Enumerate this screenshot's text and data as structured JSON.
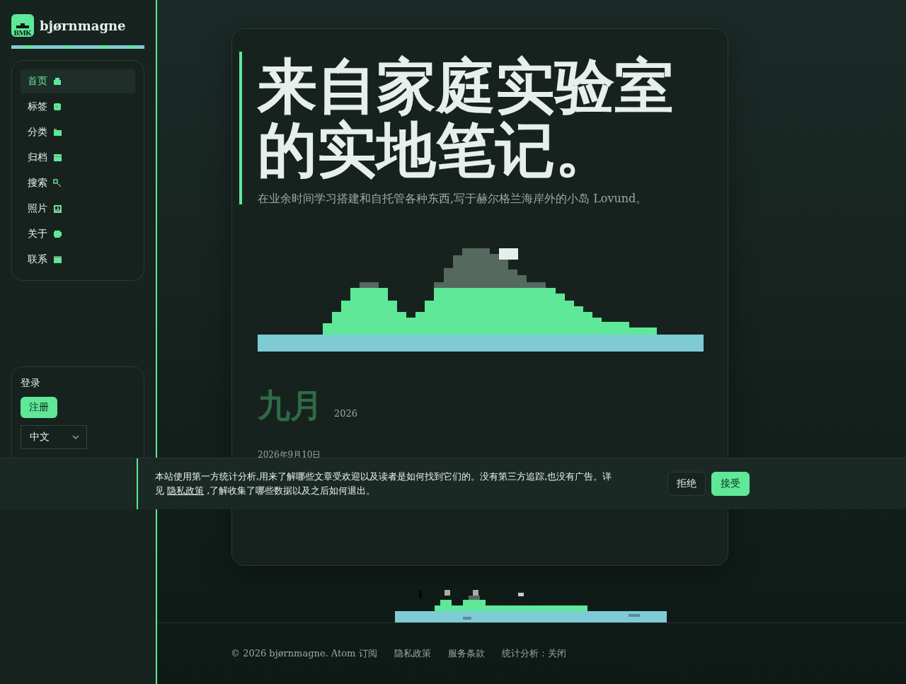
{
  "brand": {
    "logo_text": "BMK",
    "name": "bjørnmagne"
  },
  "nav": [
    {
      "label": "首页",
      "kind": "house",
      "selected": true
    },
    {
      "label": "标签",
      "kind": "tag",
      "selected": false
    },
    {
      "label": "分类",
      "kind": "folder",
      "selected": false
    },
    {
      "label": "归档",
      "kind": "box",
      "selected": false
    },
    {
      "label": "搜索",
      "kind": "search",
      "selected": false
    },
    {
      "label": "照片",
      "kind": "photo",
      "selected": false
    },
    {
      "label": "关于",
      "kind": "dot",
      "selected": false
    },
    {
      "label": "联系",
      "kind": "mail",
      "selected": false
    }
  ],
  "account": {
    "login": "登录",
    "register": "注册",
    "language": "中文"
  },
  "hero": {
    "title": "来自家庭实验室的实地笔记。",
    "subtitle": "在业余时间学习搭建和自托管各种东西,写于赫尔格兰海岸外的小岛 Lovund。"
  },
  "archive": {
    "month": "九月",
    "year": "2026",
    "date": "2026年9月10日"
  },
  "cookie_banner": {
    "text": "本站使用第一方统计分析,用来了解哪些文章受欢迎以及读者是如何找到它们的。没有第三方追踪,也没有广告。详见 ",
    "link": "隐私政策",
    "text_after": " ,了解收集了哪些数据以及之后如何退出。",
    "buttons": [
      {
        "label": "拒绝",
        "kind": "secondary"
      },
      {
        "label": "接受",
        "kind": "primary"
      }
    ]
  },
  "footer": {
    "copyright": "© 2026 bjørnmagne. Atom 订阅",
    "links": [
      "隐私政策",
      "服务条款",
      "统计分析：关闭"
    ]
  }
}
